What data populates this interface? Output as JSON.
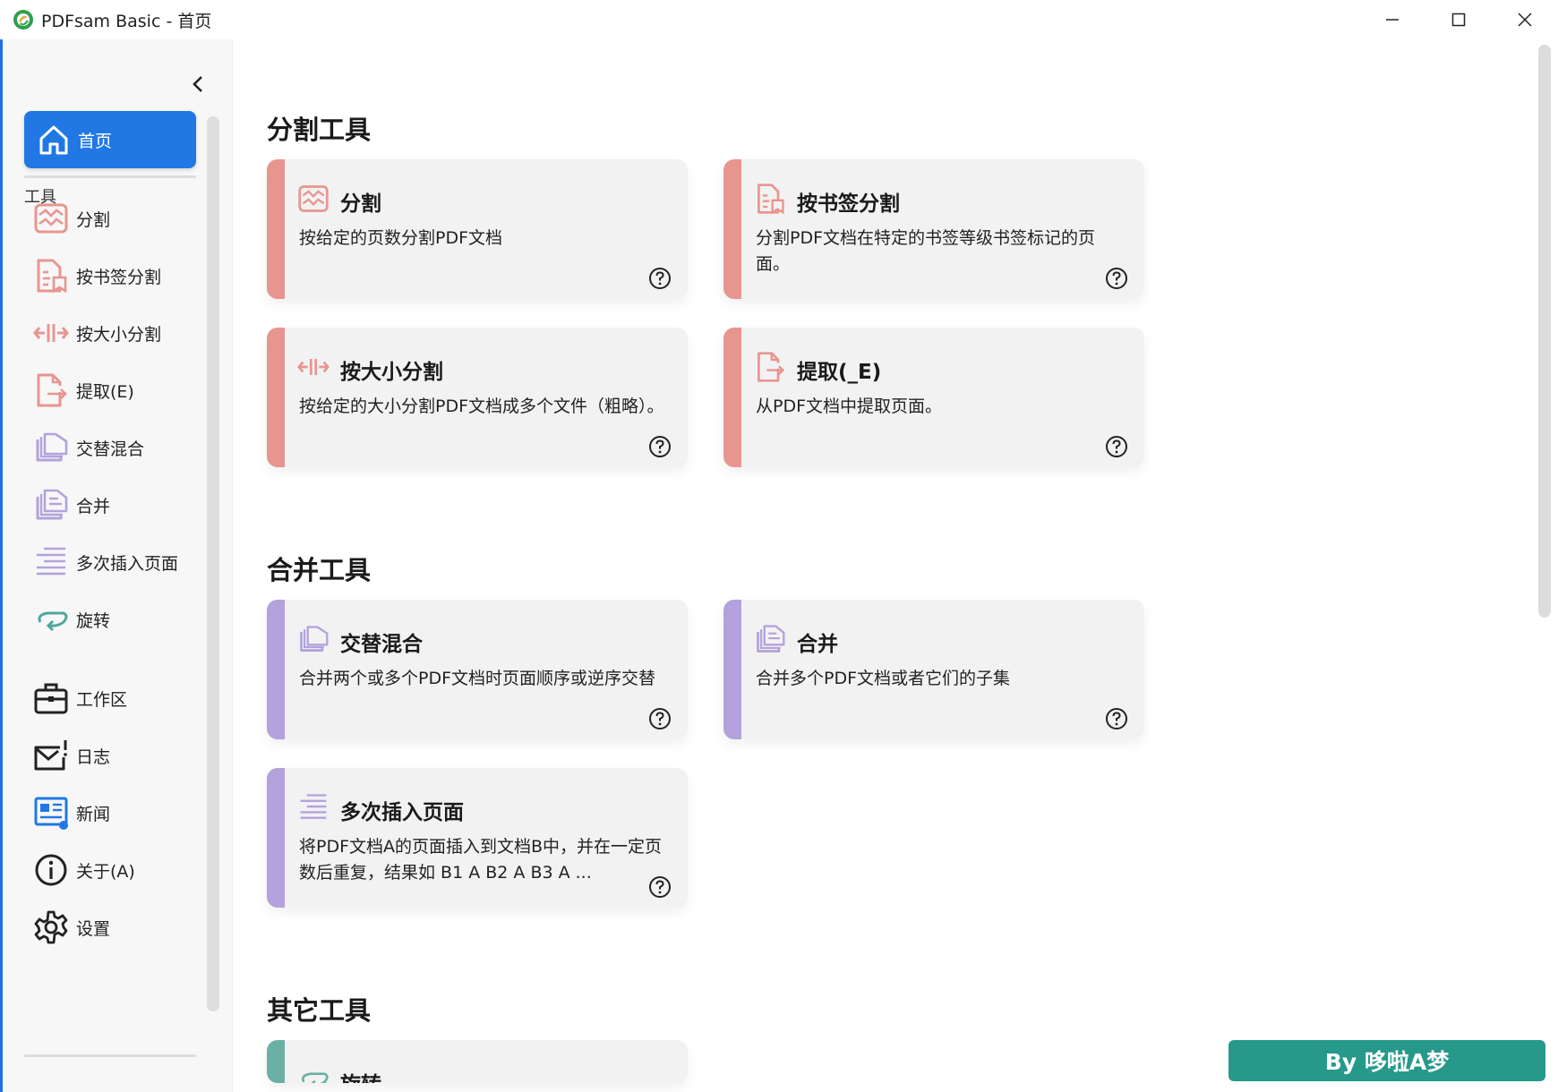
{
  "window": {
    "title": "PDFsam Basic - 首页",
    "controls": [
      "minimize-icon",
      "maximize-icon",
      "close-icon"
    ]
  },
  "sidebar": {
    "home": {
      "label": "首页",
      "icon": "home-icon",
      "active": true
    },
    "section_label": "工具",
    "tools": [
      {
        "label": "分割",
        "icon": "split-icon"
      },
      {
        "label": "按书签分割",
        "icon": "bookmark-split-icon"
      },
      {
        "label": "按大小分割",
        "icon": "size-split-icon"
      },
      {
        "label": "提取(E)",
        "icon": "extract-icon"
      },
      {
        "label": "交替混合",
        "icon": "alternate-mix-icon"
      },
      {
        "label": "合并",
        "icon": "merge-icon"
      },
      {
        "label": "多次插入页面",
        "icon": "insert-pages-icon"
      },
      {
        "label": "旋转",
        "icon": "rotate-icon"
      }
    ],
    "utilities": [
      {
        "label": "工作区",
        "icon": "briefcase-icon"
      },
      {
        "label": "日志",
        "icon": "log-icon"
      },
      {
        "label": "新闻",
        "icon": "news-icon"
      },
      {
        "label": "关于(A)",
        "icon": "info-icon"
      },
      {
        "label": "设置",
        "icon": "gear-icon"
      }
    ]
  },
  "main": {
    "split_section": {
      "title": "分割工具",
      "cards": [
        {
          "title": "分割",
          "desc": "按给定的页数分割PDF文档",
          "icon": "split-icon"
        },
        {
          "title": "按书签分割",
          "desc": "分割PDF文档在特定的书签等级书签标记的页面。",
          "icon": "bookmark-split-icon"
        },
        {
          "title": "按大小分割",
          "desc": "按给定的大小分割PDF文档成多个文件（粗略）。",
          "icon": "size-split-icon"
        },
        {
          "title": "提取(_E)",
          "desc": "从PDF文档中提取页面。",
          "icon": "extract-icon"
        }
      ]
    },
    "merge_section": {
      "title": "合并工具",
      "cards": [
        {
          "title": "交替混合",
          "desc": "合并两个或多个PDF文档时页面顺序或逆序交替",
          "icon": "alternate-mix-icon"
        },
        {
          "title": "合并",
          "desc": "合并多个PDF文档或者它们的子集",
          "icon": "merge-icon"
        },
        {
          "title": "多次插入页面",
          "desc": "将PDF文档A的页面插入到文档B中，并在一定页数后重复，结果如 B1 A B2 A B3 A ...",
          "icon": "insert-pages-icon"
        }
      ]
    },
    "other_section": {
      "title": "其它工具",
      "cards": [
        {
          "title": "旋转",
          "desc": "",
          "icon": "rotate-icon"
        }
      ]
    }
  },
  "footer_banner": "By 哆啦A梦",
  "colors": {
    "accent": "#2178e5",
    "split_stripe": "#e8958f",
    "merge_stripe": "#b3a2dc",
    "other_stripe": "#6ab0a4",
    "banner": "#26998b"
  }
}
